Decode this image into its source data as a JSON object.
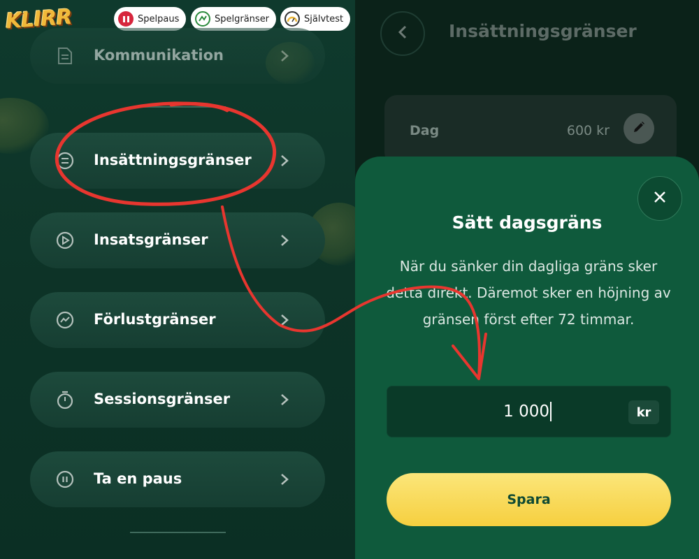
{
  "brand": {
    "logo_text": "KLIRR"
  },
  "top_pills": [
    {
      "label": "Spelpaus",
      "icon": "pause-icon",
      "color": "#d7263d"
    },
    {
      "label": "Spelgränser",
      "icon": "limits-icon",
      "color": "#2a8a3c"
    },
    {
      "label": "Självtest",
      "icon": "gauge-icon",
      "color": "#f0b93a"
    }
  ],
  "menu": {
    "items": [
      {
        "label": "Kommunikation",
        "icon": "document-icon"
      },
      {
        "label": "Insättningsgränser",
        "icon": "deposit-limit-icon"
      },
      {
        "label": "Insatsgränser",
        "icon": "play-icon"
      },
      {
        "label": "Förlustgränser",
        "icon": "trend-icon"
      },
      {
        "label": "Sessionsgränser",
        "icon": "stopwatch-icon"
      },
      {
        "label": "Ta en paus",
        "icon": "pause-circle-icon"
      }
    ]
  },
  "detail": {
    "title": "Insättningsgränser",
    "day_label": "Dag",
    "day_value": "600 kr"
  },
  "modal": {
    "title": "Sätt dagsgräns",
    "body": "När du sänker din dagliga gräns sker detta direkt. Däremot sker en höjning av gränsen först efter 72 timmar.",
    "amount": "1 000",
    "unit": "kr",
    "save_label": "Spara"
  },
  "colors": {
    "accent_yellow": "#f6cf3f",
    "modal_green": "#0f5a3c",
    "annotation_red": "#e8362f"
  }
}
